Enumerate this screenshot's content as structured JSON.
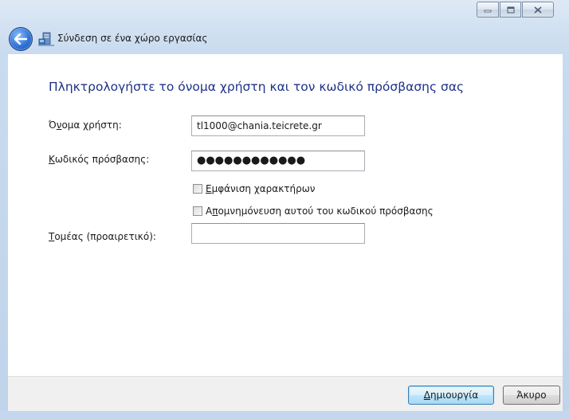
{
  "window": {
    "title": "Σύνδεση σε ένα χώρο εργασίας"
  },
  "caption_buttons": {
    "minimize": "minimize",
    "maximize": "maximize",
    "close": "close"
  },
  "main": {
    "heading": "Πληκτρολογήστε το όνομα χρήστη και τον κωδικό πρόσβασης σας",
    "username": {
      "label_pre": "Ό",
      "label_ul": "ν",
      "label_post": "ομα χρήστη:",
      "value": "tl1000@chania.teicrete.gr"
    },
    "password": {
      "label_ul": "Κ",
      "label_post": "ωδικός πρόσβασης:",
      "value": "●●●●●●●●●●●●"
    },
    "show_chars": {
      "label_ul": "Ε",
      "label_post": "μφάνιση χαρακτήρων"
    },
    "remember": {
      "label_pre": "Α",
      "label_ul": "π",
      "label_post": "ομνημόνευση αυτού του κωδικού πρόσβασης"
    },
    "domain": {
      "label_ul": "Τ",
      "label_post": "ομέας (προαιρετικό):",
      "value": ""
    }
  },
  "footer": {
    "create_ul": "Δ",
    "create_post": "ημιουργία",
    "cancel": "Άκυρο"
  }
}
